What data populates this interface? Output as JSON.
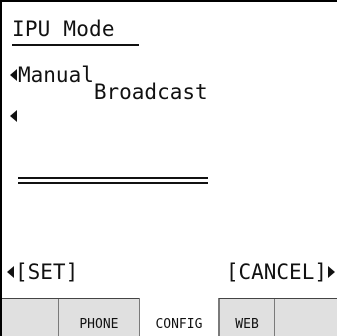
{
  "screen": {
    "title": "IPU Mode",
    "options": [
      {
        "label": "Manual"
      },
      {
        "label": "Broadcast"
      }
    ],
    "softkeys": {
      "left": "[SET]",
      "right": "[CANCEL]"
    },
    "tabs": [
      {
        "label": ""
      },
      {
        "label": "PHONE"
      },
      {
        "label": "CONFIG"
      },
      {
        "label": "WEB"
      },
      {
        "label": ""
      }
    ],
    "selected_option": "Broadcast",
    "active_tab": "CONFIG"
  }
}
